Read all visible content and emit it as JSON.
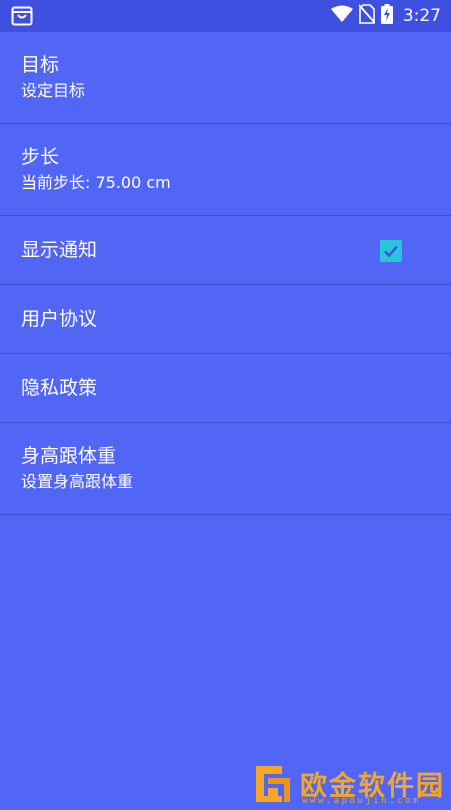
{
  "status_bar": {
    "time": "3:27",
    "left_icon": "shopping-bag-icon",
    "icons": [
      "wifi-icon",
      "no-sim-icon",
      "battery-charging-icon"
    ]
  },
  "settings": [
    {
      "title": "目标",
      "subtitle": "设定目标"
    },
    {
      "title": "步长",
      "subtitle": "当前步长: 75.00 cm"
    },
    {
      "title": "显示通知",
      "checked": true
    },
    {
      "title": "用户协议"
    },
    {
      "title": "隐私政策"
    },
    {
      "title": "身高跟体重",
      "subtitle": "设置身高跟体重"
    }
  ],
  "watermark": {
    "text": "欧金软件园",
    "url": "www.apoujin.com"
  },
  "colors": {
    "background": "#5266f6",
    "status_bar": "#3f4fe0",
    "checkbox": "#28c6d8",
    "watermark": "#f5a623"
  }
}
